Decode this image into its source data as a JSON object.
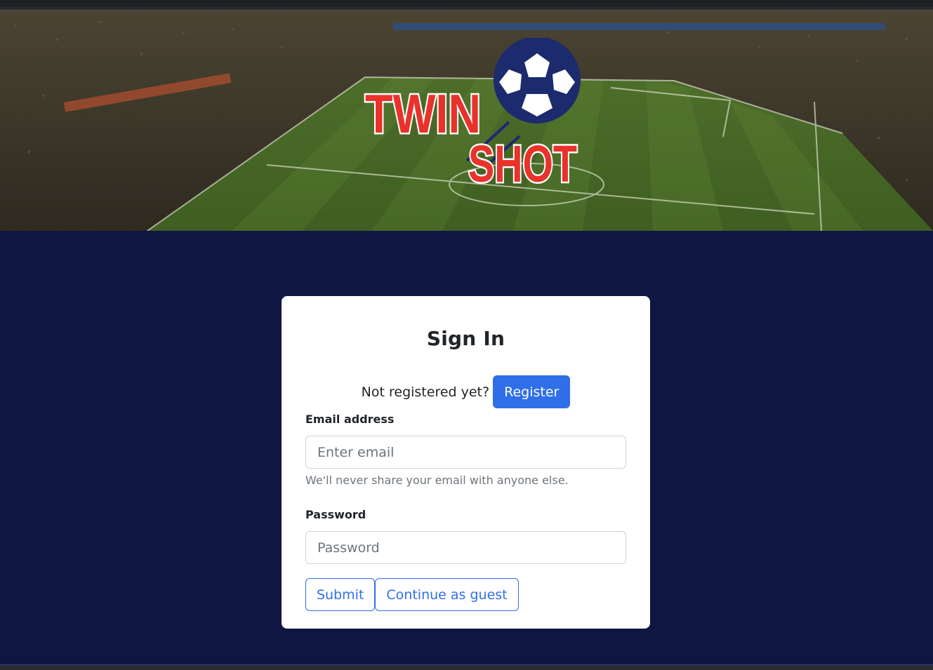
{
  "hero": {
    "logo_word_1": "TWIN",
    "logo_word_2": "SHOT",
    "logo_red": "#e8322a",
    "logo_navy": "#1c2a6e"
  },
  "colors": {
    "background": "#0f1641",
    "card": "#ffffff",
    "accent": "#2f6fe9"
  },
  "signin": {
    "title": "Sign In",
    "register_prompt": "Not registered yet?",
    "register_button": "Register",
    "email_label": "Email address",
    "email_placeholder": "Enter email",
    "email_value": "",
    "email_help": "We'll never share your email with anyone else.",
    "password_label": "Password",
    "password_placeholder": "Password",
    "password_value": "",
    "submit_button": "Submit",
    "guest_button": "Continue as guest"
  }
}
